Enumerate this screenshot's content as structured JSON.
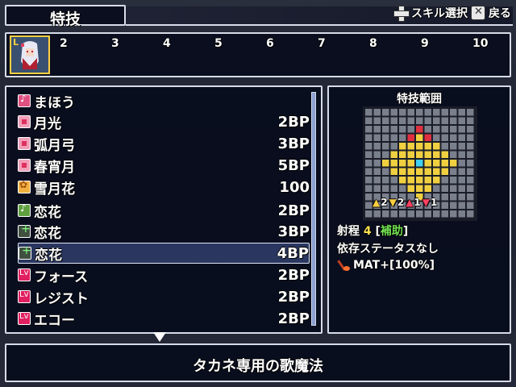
{
  "header": {
    "title": "特技",
    "help_select": "スキル選択",
    "help_back": "戻る",
    "dpad_icon": "dpad-icon",
    "x_icon": "x-button-icon"
  },
  "party": {
    "leader_badge": "L",
    "slots": [
      "2",
      "3",
      "4",
      "5",
      "6",
      "7",
      "8",
      "9",
      "10"
    ]
  },
  "skills": [
    {
      "name": "まほう",
      "cost": "",
      "icon": "music-magic-icon"
    },
    {
      "name": "月光",
      "cost": "2BP",
      "icon": "pink-skill-icon"
    },
    {
      "name": "弧月弓",
      "cost": "3BP",
      "icon": "pink-skill-icon"
    },
    {
      "name": "春宵月",
      "cost": "5BP",
      "icon": "pink-skill-icon"
    },
    {
      "name": "雪月花",
      "cost": "100",
      "icon": "flower-skill-icon"
    },
    {
      "name": "恋花",
      "cost": "2BP",
      "icon": "green-music-icon"
    },
    {
      "name": "恋花",
      "cost": "3BP",
      "icon": "plus-skill-icon"
    },
    {
      "name": "恋花",
      "cost": "4BP",
      "icon": "plus-skill-icon"
    },
    {
      "name": "フォース",
      "cost": "2BP",
      "icon": "lv-skill-icon"
    },
    {
      "name": "レジスト",
      "cost": "2BP",
      "icon": "lv-skill-icon"
    },
    {
      "name": "エコー",
      "cost": "2BP",
      "icon": "lv-skill-icon"
    }
  ],
  "selected_index": 7,
  "range": {
    "title": "特技範囲",
    "stats": [
      "2",
      "2",
      "1",
      "1"
    ],
    "range_label": "射程",
    "range_value": "4",
    "range_tag_open": "[",
    "range_tag": "補助",
    "range_tag_close": "]",
    "dependency": "依存ステータスなし",
    "effect": "MAT+[100%]"
  },
  "description": "タカネ専用の歌魔法",
  "colors": {
    "accent_yellow": "#ffe050",
    "accent_green": "#70e050",
    "grid_area": "#f0d040",
    "grid_center": "#40d0f0",
    "grid_red": "#e03040"
  }
}
